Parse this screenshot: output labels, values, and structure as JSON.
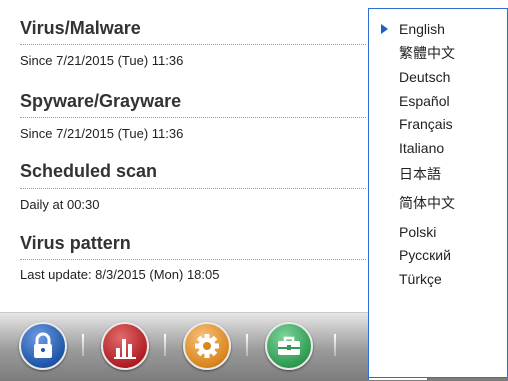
{
  "sections": [
    {
      "title": "Virus/Malware",
      "detail": "Since 7/21/2015 (Tue) 11:36"
    },
    {
      "title": "Spyware/Grayware",
      "detail": "Since 7/21/2015 (Tue) 11:36"
    },
    {
      "title": "Scheduled scan",
      "detail": "Daily at 00:30"
    },
    {
      "title": "Virus pattern",
      "detail": "Last update: 8/3/2015 (Mon) 18:05"
    }
  ],
  "language_menu": {
    "selected": "English",
    "items": [
      "English",
      "繁體中文",
      "Deutsch",
      "Español",
      "Français",
      "Italiano",
      "日本語",
      "简体中文",
      "Polski",
      "Русский",
      "Türkçe"
    ]
  },
  "toolbar": {
    "buttons": [
      {
        "icon": "lock-icon",
        "color": "#1f56a7"
      },
      {
        "icon": "bar-chart-icon",
        "color": "#b01f26"
      },
      {
        "icon": "gear-icon",
        "color": "#d9861e"
      },
      {
        "icon": "toolbox-icon",
        "color": "#2f9b52"
      },
      {
        "icon": "globe-icon",
        "color": "#ef6b0f",
        "active": true
      }
    ]
  },
  "colors": {
    "accent": "#2f6fd6",
    "selected_arrow": "#1e5fc5"
  }
}
